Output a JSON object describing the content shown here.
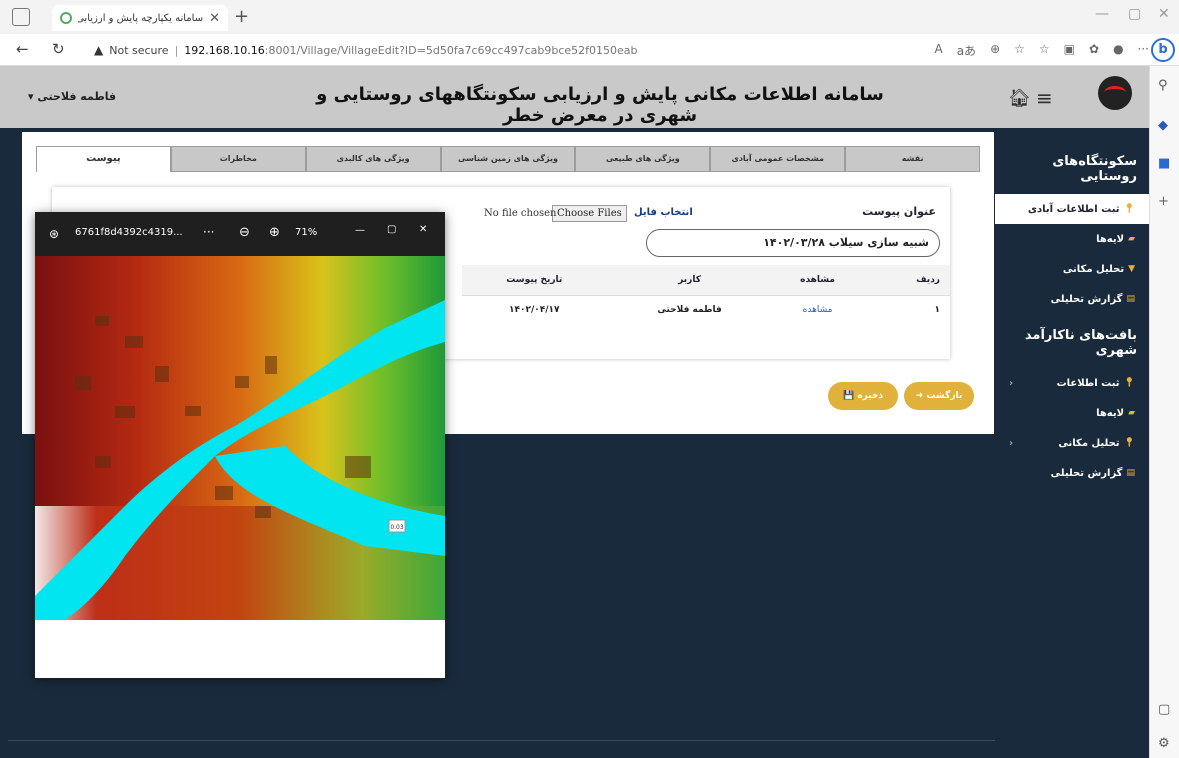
{
  "browser": {
    "tab_title": "سامانه یکپارچه پایش و ارزیابی اطلا",
    "new_tab": "+",
    "security": "Not secure",
    "url_host": "192.168.10.16",
    "url_path": ":8001/Village/VillageEdit?ID=5d50fa7c69cc497cab9bce52f0150eab",
    "zoom_icons": [
      "A",
      "aあ",
      "⊕",
      "☆"
    ]
  },
  "app": {
    "title": "سامانه اطلاعات مکانی پایش و ارزیابی سکونتگاههای روستایی و شهری در معرض خطر",
    "user": "فاطمه فلاحتی",
    "user_caret": "▾"
  },
  "sidebar": {
    "section1": "سکونتگاه‌های روستایی",
    "section1_items": [
      {
        "label": "ثبت اطلاعات آبادی",
        "icon": "map-pin-icon",
        "active": true
      },
      {
        "label": "لایه‌ها",
        "icon": "layers-icon"
      },
      {
        "label": "تحلیل مکانی",
        "icon": "filter-icon"
      },
      {
        "label": "گزارش تحلیلی",
        "icon": "chart-icon"
      }
    ],
    "section2": "بافت‌های ناکارآمد شهری",
    "section2_items": [
      {
        "label": "ثبت اطلاعات",
        "icon": "map-pin-icon",
        "chevron": true
      },
      {
        "label": "لایه‌ها",
        "icon": "layers-icon"
      },
      {
        "label": "تحلیل مکانی",
        "icon": "map-pin-icon",
        "chevron": true
      },
      {
        "label": "گزارش تحلیلی",
        "icon": "chart-icon"
      }
    ]
  },
  "tabs": [
    "نقشه",
    "مشخصات عمومی آبادی",
    "ویژگی های طبیعی",
    "ویژگی های زمین شناسی",
    "ویژگی های کالبدی",
    "مخاطرات",
    "پیوست"
  ],
  "form": {
    "title_label": "عنوان پیوست",
    "title_value": "شبیه سازی سیلاب  ۱۴۰۲/۰۳/۲۸",
    "file_label": "انتخاب فایل",
    "file_button": "Choose Files",
    "file_status": "No file chosen"
  },
  "table": {
    "headers": [
      "ردیف",
      "مشاهده",
      "کاربر",
      "تاریخ پیوست"
    ],
    "rows": [
      {
        "index": "۱",
        "view": "مشاهده",
        "user": "فاطمه فلاحتی",
        "date": "۱۴۰۲/۰۴/۱۷"
      }
    ]
  },
  "buttons": {
    "back": "➜ بازگشت",
    "save": "💾 ذخیره"
  },
  "viewer": {
    "filename": "6761f8d4392c4319...",
    "more": "···",
    "zoom": "71%",
    "badge": "0.03"
  },
  "colors": {
    "header_bg": "#c9c9c9",
    "nav_bg": "#1a2a3d",
    "accent": "#e0b23c",
    "flood": "#00e5f0"
  }
}
